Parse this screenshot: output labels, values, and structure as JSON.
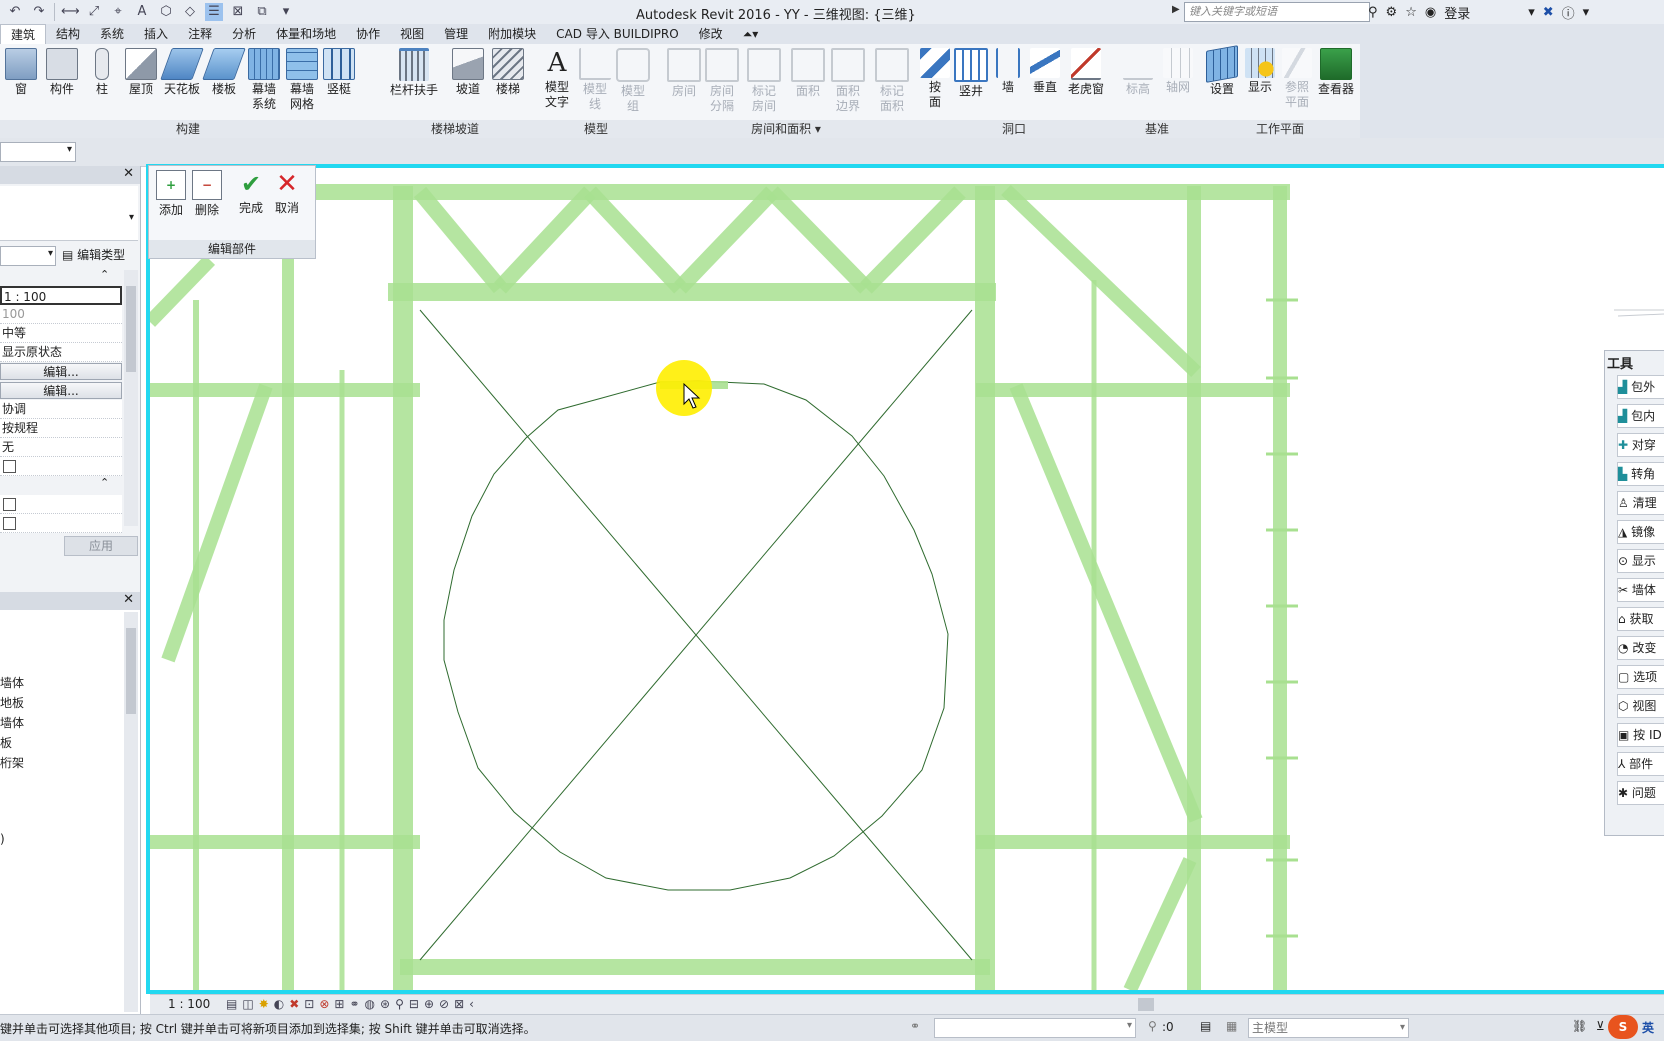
{
  "title_bar": {
    "app_title": "Autodesk Revit 2016 -     YY - 三维视图: {三维}",
    "search_placeholder": "键入关键字或短语",
    "login_label": "登录"
  },
  "tabs": [
    "建筑",
    "结构",
    "系统",
    "插入",
    "注释",
    "分析",
    "体量和场地",
    "协作",
    "视图",
    "管理",
    "附加模块",
    "CAD 导入 BUILDIPRO",
    "修改"
  ],
  "active_tab": "建筑",
  "ribbon": {
    "build": {
      "label": "构建",
      "buttons": [
        "窗",
        "构件",
        "柱",
        "屋顶",
        "天花板",
        "楼板",
        "幕墙\n系统",
        "幕墙\n网格",
        "竖梃"
      ]
    },
    "stairs": {
      "label": "楼梯坡道",
      "buttons": [
        "栏杆扶手",
        "坡道",
        "楼梯"
      ]
    },
    "model": {
      "label": "模型",
      "buttons": [
        "模型\n文字",
        "模型\n线",
        "模型\n组"
      ]
    },
    "room": {
      "label": "房间和面积",
      "buttons": [
        "房间",
        "房间\n分隔",
        "标记\n房间",
        "面积",
        "面积\n边界",
        "标记\n面积"
      ]
    },
    "opening": {
      "label": "洞口",
      "buttons": [
        "按\n面",
        "竖井",
        "墙",
        "垂直",
        "老虎窗"
      ]
    },
    "datum": {
      "label": "基准",
      "buttons": [
        "标高",
        "轴网"
      ]
    },
    "workplane": {
      "label": "工作平面",
      "buttons": [
        "设置",
        "显示",
        "参照\n平面",
        "查看器"
      ]
    }
  },
  "edit_assembly": {
    "buttons": [
      "添加",
      "删除",
      "完成",
      "取消"
    ],
    "label": "编辑部件"
  },
  "properties": {
    "edit_type_label": "编辑类型",
    "rows": [
      "1 : 100",
      "100",
      "中等",
      "显示原状态",
      "编辑...",
      "编辑...",
      "协调",
      "按规程",
      "无"
    ],
    "apply_label": "应用"
  },
  "browser": {
    "items": [
      "墙体",
      "地板",
      "墙体",
      "板",
      "桁架",
      ")"
    ]
  },
  "tools_palette": {
    "title": "工具",
    "items": [
      "包外",
      "包内",
      "对穿",
      "转角",
      "清理",
      "镜像",
      "显示",
      "墙体",
      "获取",
      "改变",
      "选项",
      "视图",
      "按 ID",
      "部件",
      "问题"
    ]
  },
  "view_bar": {
    "scale": "1 : 100"
  },
  "status_bar": {
    "message": "键并单击可选择其他项目; 按 Ctrl 键并单击可将新项目添加到选择集; 按 Shift 键并单击可取消选择。",
    "count": ":0",
    "model_label": "主模型",
    "ime_label": "英"
  },
  "colors": {
    "frame_green": "#a8e090",
    "line_dark_green": "#2f6b2f",
    "highlight_yellow": "#ffee00",
    "view_border_cyan": "#22d8f0"
  }
}
